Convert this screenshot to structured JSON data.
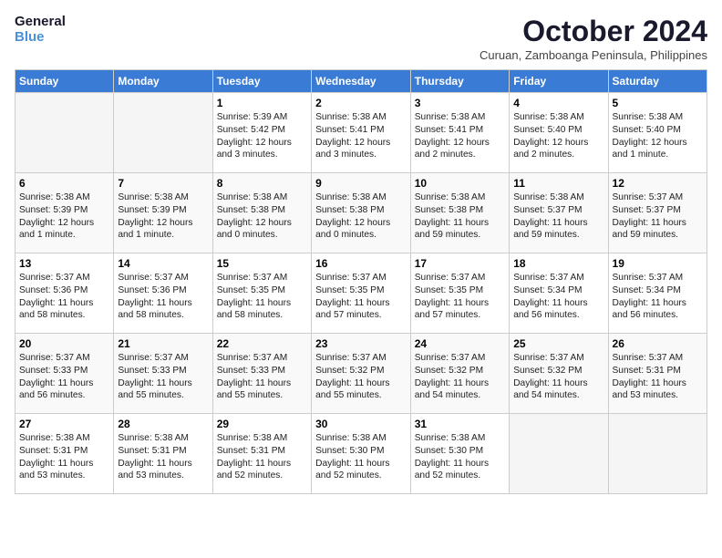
{
  "logo": {
    "line1": "General",
    "line2": "Blue"
  },
  "title": "October 2024",
  "subtitle": "Curuan, Zamboanga Peninsula, Philippines",
  "headers": [
    "Sunday",
    "Monday",
    "Tuesday",
    "Wednesday",
    "Thursday",
    "Friday",
    "Saturday"
  ],
  "weeks": [
    [
      {
        "day": "",
        "info": ""
      },
      {
        "day": "",
        "info": ""
      },
      {
        "day": "1",
        "info": "Sunrise: 5:39 AM\nSunset: 5:42 PM\nDaylight: 12 hours\nand 3 minutes."
      },
      {
        "day": "2",
        "info": "Sunrise: 5:38 AM\nSunset: 5:41 PM\nDaylight: 12 hours\nand 3 minutes."
      },
      {
        "day": "3",
        "info": "Sunrise: 5:38 AM\nSunset: 5:41 PM\nDaylight: 12 hours\nand 2 minutes."
      },
      {
        "day": "4",
        "info": "Sunrise: 5:38 AM\nSunset: 5:40 PM\nDaylight: 12 hours\nand 2 minutes."
      },
      {
        "day": "5",
        "info": "Sunrise: 5:38 AM\nSunset: 5:40 PM\nDaylight: 12 hours\nand 1 minute."
      }
    ],
    [
      {
        "day": "6",
        "info": "Sunrise: 5:38 AM\nSunset: 5:39 PM\nDaylight: 12 hours\nand 1 minute."
      },
      {
        "day": "7",
        "info": "Sunrise: 5:38 AM\nSunset: 5:39 PM\nDaylight: 12 hours\nand 1 minute."
      },
      {
        "day": "8",
        "info": "Sunrise: 5:38 AM\nSunset: 5:38 PM\nDaylight: 12 hours\nand 0 minutes."
      },
      {
        "day": "9",
        "info": "Sunrise: 5:38 AM\nSunset: 5:38 PM\nDaylight: 12 hours\nand 0 minutes."
      },
      {
        "day": "10",
        "info": "Sunrise: 5:38 AM\nSunset: 5:38 PM\nDaylight: 11 hours\nand 59 minutes."
      },
      {
        "day": "11",
        "info": "Sunrise: 5:38 AM\nSunset: 5:37 PM\nDaylight: 11 hours\nand 59 minutes."
      },
      {
        "day": "12",
        "info": "Sunrise: 5:37 AM\nSunset: 5:37 PM\nDaylight: 11 hours\nand 59 minutes."
      }
    ],
    [
      {
        "day": "13",
        "info": "Sunrise: 5:37 AM\nSunset: 5:36 PM\nDaylight: 11 hours\nand 58 minutes."
      },
      {
        "day": "14",
        "info": "Sunrise: 5:37 AM\nSunset: 5:36 PM\nDaylight: 11 hours\nand 58 minutes."
      },
      {
        "day": "15",
        "info": "Sunrise: 5:37 AM\nSunset: 5:35 PM\nDaylight: 11 hours\nand 58 minutes."
      },
      {
        "day": "16",
        "info": "Sunrise: 5:37 AM\nSunset: 5:35 PM\nDaylight: 11 hours\nand 57 minutes."
      },
      {
        "day": "17",
        "info": "Sunrise: 5:37 AM\nSunset: 5:35 PM\nDaylight: 11 hours\nand 57 minutes."
      },
      {
        "day": "18",
        "info": "Sunrise: 5:37 AM\nSunset: 5:34 PM\nDaylight: 11 hours\nand 56 minutes."
      },
      {
        "day": "19",
        "info": "Sunrise: 5:37 AM\nSunset: 5:34 PM\nDaylight: 11 hours\nand 56 minutes."
      }
    ],
    [
      {
        "day": "20",
        "info": "Sunrise: 5:37 AM\nSunset: 5:33 PM\nDaylight: 11 hours\nand 56 minutes."
      },
      {
        "day": "21",
        "info": "Sunrise: 5:37 AM\nSunset: 5:33 PM\nDaylight: 11 hours\nand 55 minutes."
      },
      {
        "day": "22",
        "info": "Sunrise: 5:37 AM\nSunset: 5:33 PM\nDaylight: 11 hours\nand 55 minutes."
      },
      {
        "day": "23",
        "info": "Sunrise: 5:37 AM\nSunset: 5:32 PM\nDaylight: 11 hours\nand 55 minutes."
      },
      {
        "day": "24",
        "info": "Sunrise: 5:37 AM\nSunset: 5:32 PM\nDaylight: 11 hours\nand 54 minutes."
      },
      {
        "day": "25",
        "info": "Sunrise: 5:37 AM\nSunset: 5:32 PM\nDaylight: 11 hours\nand 54 minutes."
      },
      {
        "day": "26",
        "info": "Sunrise: 5:37 AM\nSunset: 5:31 PM\nDaylight: 11 hours\nand 53 minutes."
      }
    ],
    [
      {
        "day": "27",
        "info": "Sunrise: 5:38 AM\nSunset: 5:31 PM\nDaylight: 11 hours\nand 53 minutes."
      },
      {
        "day": "28",
        "info": "Sunrise: 5:38 AM\nSunset: 5:31 PM\nDaylight: 11 hours\nand 53 minutes."
      },
      {
        "day": "29",
        "info": "Sunrise: 5:38 AM\nSunset: 5:31 PM\nDaylight: 11 hours\nand 52 minutes."
      },
      {
        "day": "30",
        "info": "Sunrise: 5:38 AM\nSunset: 5:30 PM\nDaylight: 11 hours\nand 52 minutes."
      },
      {
        "day": "31",
        "info": "Sunrise: 5:38 AM\nSunset: 5:30 PM\nDaylight: 11 hours\nand 52 minutes."
      },
      {
        "day": "",
        "info": ""
      },
      {
        "day": "",
        "info": ""
      }
    ]
  ]
}
